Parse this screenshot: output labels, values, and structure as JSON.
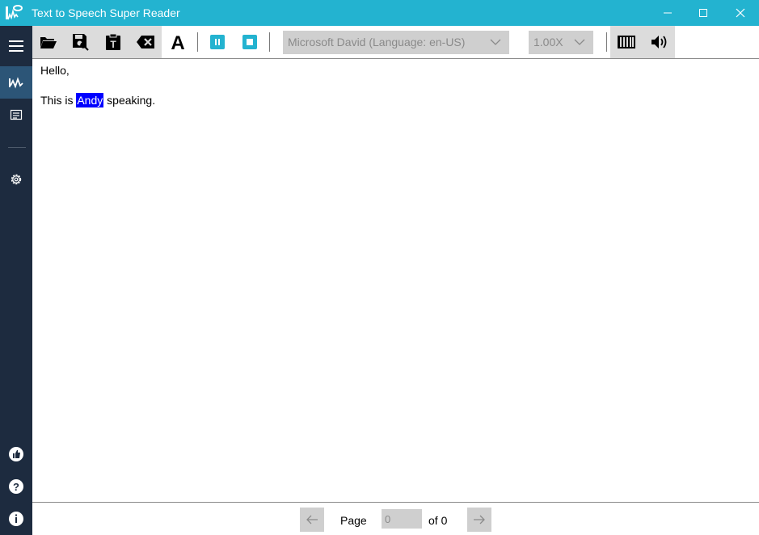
{
  "window": {
    "title": "Text to Speech Super Reader",
    "accent_color": "#23b3d0",
    "sidebar_color": "#1d2b3f"
  },
  "sidebar": {
    "items": [
      {
        "name": "menu",
        "icon": "hamburger-icon"
      },
      {
        "name": "reader",
        "icon": "voice-wave-icon",
        "active": true
      },
      {
        "name": "documents",
        "icon": "list-icon"
      },
      {
        "name": "settings",
        "icon": "gear-icon"
      },
      {
        "name": "feedback",
        "icon": "thumbs-up-icon"
      },
      {
        "name": "help",
        "icon": "question-icon"
      },
      {
        "name": "about",
        "icon": "info-icon"
      }
    ]
  },
  "toolbar": {
    "buttons": [
      "open-folder-icon",
      "save-as-icon",
      "paste-text-icon",
      "clear-icon",
      "font-icon",
      "pause-icon",
      "stop-icon",
      "speed-meter-icon",
      "volume-icon"
    ],
    "voice_selected": "Microsoft David (Language: en-US)",
    "speed_selected": "1.00X"
  },
  "document": {
    "line1": "Hello,",
    "line2_before": "This is ",
    "line2_highlight": "Andy",
    "line2_after": " speaking.",
    "highlight_color": "#0000ff"
  },
  "footer": {
    "page_label": "Page",
    "page_value": "0",
    "of_label": "of 0"
  }
}
